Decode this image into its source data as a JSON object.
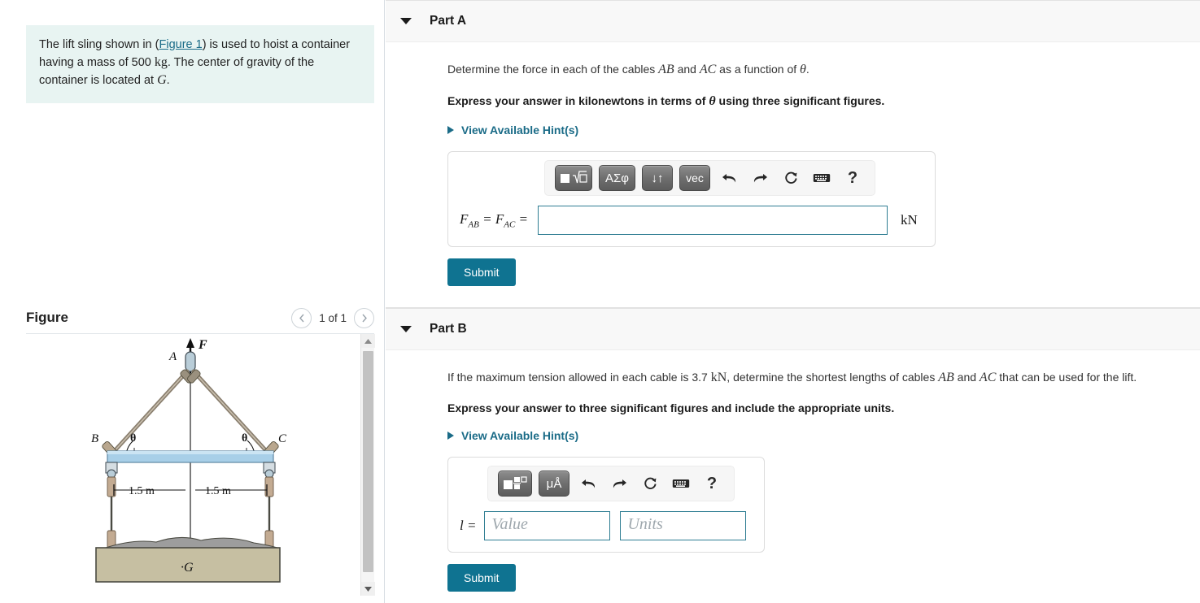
{
  "problem": {
    "text_before_link": "The lift sling shown in (",
    "figure_link": "Figure 1",
    "text_after_link": ") is used to hoist a container having a mass of 500 ",
    "mass_unit": "kg",
    "text_cg": ". The center of gravity of the container is located at ",
    "cg_point": "G",
    "period": "."
  },
  "figure": {
    "title": "Figure",
    "counter": "1 of 1",
    "prev_icon": "chevron-left-icon",
    "next_icon": "chevron-right-icon",
    "labels": {
      "force": "F",
      "point_a": "A",
      "point_b": "B",
      "point_c": "C",
      "theta_left": "θ",
      "theta_right": "θ",
      "dim_left": "1.5 m",
      "dim_right": "1.5 m",
      "cg": "·G"
    },
    "colors": {
      "bar": "#a8cfe8",
      "bar_edge": "#5f87a3",
      "container": "#c6bfa2",
      "container_edge": "#4a4a42",
      "gravel": "#9d9d9d",
      "cable": "#8a7f6f"
    }
  },
  "partA": {
    "title": "Part A",
    "caret_icon": "caret-down-icon",
    "prompt_pre": "Determine the force in each of the cables ",
    "prompt_ab": "AB",
    "prompt_mid": " and ",
    "prompt_ac": "AC",
    "prompt_post": " as a function of ",
    "prompt_theta": "θ",
    "prompt_end": ".",
    "instruction_pre": "Express your answer in kilonewtons in terms of ",
    "instruction_theta": "θ",
    "instruction_post": " using three significant figures.",
    "hints_label": "View Available Hint(s)",
    "toolbar": {
      "template_label": "■√□",
      "greek_label": "ΑΣφ",
      "arrows_label": "↓↑",
      "vec_label": "vec",
      "undo_icon": "undo-icon",
      "redo_icon": "redo-icon",
      "reset_icon": "reset-icon",
      "keyboard_icon": "keyboard-icon",
      "help_icon": "help-icon",
      "undo_glyph": "↩",
      "redo_glyph": "↪",
      "reset_glyph": "↻",
      "keyboard_glyph": "⌨",
      "help_glyph": "?"
    },
    "answer_label_f": "F",
    "answer_label_ab": "AB",
    "answer_label_eq1": " = ",
    "answer_label_f2": "F",
    "answer_label_ac": "AC",
    "answer_label_eq2": " =",
    "answer_value": "",
    "answer_placeholder": "",
    "unit": "kN",
    "submit_label": "Submit"
  },
  "partB": {
    "title": "Part B",
    "caret_icon": "caret-down-icon",
    "prompt_pre": "If the maximum tension allowed in each cable is 3.7 ",
    "prompt_unit": "kN",
    "prompt_mid": ", determine the shortest lengths of cables ",
    "prompt_ab": "AB",
    "prompt_and": " and ",
    "prompt_ac": "AC",
    "prompt_post": " that can be used for the lift.",
    "instruction": "Express your answer to three significant figures and include the appropriate units.",
    "hints_label": "View Available Hint(s)",
    "toolbar": {
      "template_icon": "units-template-icon",
      "micro_label": "μÅ",
      "undo_icon": "undo-icon",
      "redo_icon": "redo-icon",
      "reset_icon": "reset-icon",
      "keyboard_icon": "keyboard-icon",
      "help_icon": "help-icon",
      "undo_glyph": "↩",
      "redo_glyph": "↪",
      "reset_glyph": "↻",
      "keyboard_glyph": "⌨",
      "help_glyph": "?"
    },
    "answer_label": "l =",
    "value_placeholder": "Value",
    "units_placeholder": "Units",
    "value_text": "",
    "units_text": "",
    "submit_label": "Submit"
  },
  "theme": {
    "accent": "#0f7391",
    "link": "#1a6b87",
    "problem_bg": "#e8f4f2",
    "header_bg": "#f8f8f8",
    "input_border": "#2e7d92"
  }
}
